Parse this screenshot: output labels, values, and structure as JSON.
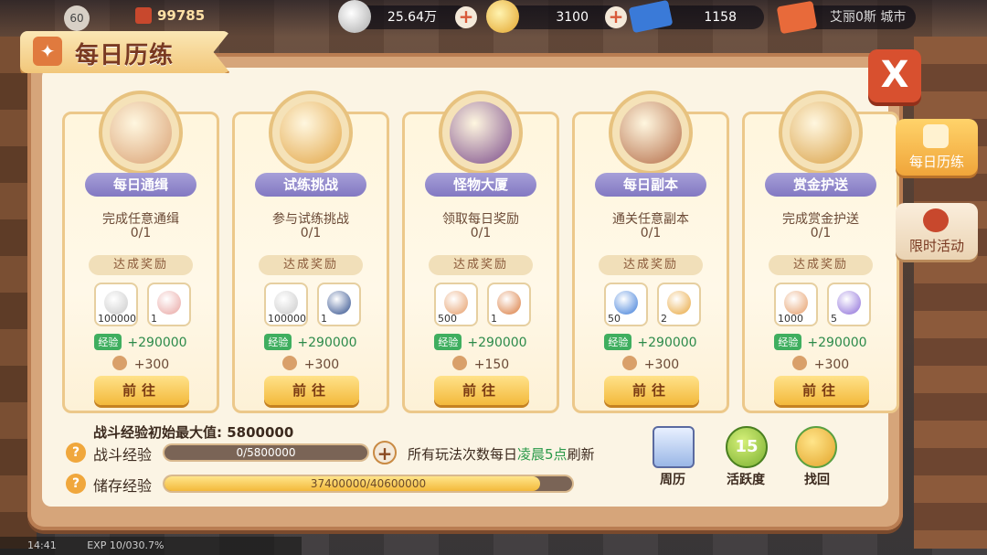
{
  "top": {
    "level": "60",
    "power": "99785",
    "silver": "25.64万",
    "gold": "3100",
    "ticket": "1158",
    "hero": "艾丽0斯 城市"
  },
  "title": "每日历练",
  "close_label": "X",
  "cards": [
    {
      "name": "每日通缉",
      "task": "完成任意通缉",
      "progress": "0/1",
      "reward_label": "达成奖励",
      "item1": "100000",
      "item2": "1",
      "exp": "+290000",
      "act": "+300",
      "go": "前往",
      "c1": "#c9c9c9",
      "c2": "#e8a3a0",
      "portrait": "#d9a072"
    },
    {
      "name": "试练挑战",
      "task": "参与试练挑战",
      "progress": "0/1",
      "reward_label": "达成奖励",
      "item1": "100000",
      "item2": "1",
      "exp": "+290000",
      "act": "+300",
      "go": "前往",
      "c1": "#c9c9c9",
      "c2": "#2b4a8a",
      "portrait": "#e2a545"
    },
    {
      "name": "怪物大厦",
      "task": "领取每日奖励",
      "progress": "0/1",
      "reward_label": "达成奖励",
      "item1": "500",
      "item2": "1",
      "exp": "+290000",
      "act": "+150",
      "go": "前往",
      "c1": "#e59a64",
      "c2": "#d9783a",
      "portrait": "#7a4a8a"
    },
    {
      "name": "每日副本",
      "task": "通关任意副本",
      "progress": "0/1",
      "reward_label": "达成奖励",
      "item1": "50",
      "item2": "2",
      "exp": "+290000",
      "act": "+300",
      "go": "前往",
      "c1": "#3a7ad8",
      "c2": "#e8a53a",
      "portrait": "#b36a45"
    },
    {
      "name": "赏金护送",
      "task": "完成赏金护送",
      "progress": "0/1",
      "reward_label": "达成奖励",
      "item1": "1000",
      "item2": "5",
      "exp": "+290000",
      "act": "+300",
      "go": "前往",
      "c1": "#e59a64",
      "c2": "#8a6ad8",
      "portrait": "#d9a045"
    }
  ],
  "exp_tag": "经验",
  "bottom": {
    "max_label": "战斗经验初始最大值: 5800000",
    "battle_label": "战斗经验",
    "battle_text": "0/5800000",
    "battle_fraction": 0,
    "stored_label": "储存经验",
    "stored_text": "37400000/40600000",
    "stored_fraction": 0.921,
    "refresh_pre": "所有玩法次数每日",
    "refresh_hl": "凌晨5点",
    "refresh_post": "刷新",
    "btn_calendar": "周历",
    "btn_activity": "活跃度",
    "activity_value": "15",
    "btn_retrieve": "找回"
  },
  "side": {
    "tab1": "每日历练",
    "tab2": "限时活动"
  },
  "status": {
    "time": "14:41",
    "exp": "EXP 10/030.7%"
  },
  "colors": {
    "accent": "#f3b93b",
    "panel": "#d6a57a",
    "ribbon": "#8278c2",
    "close": "#d8502f",
    "exp_green": "#2b8a4a"
  }
}
